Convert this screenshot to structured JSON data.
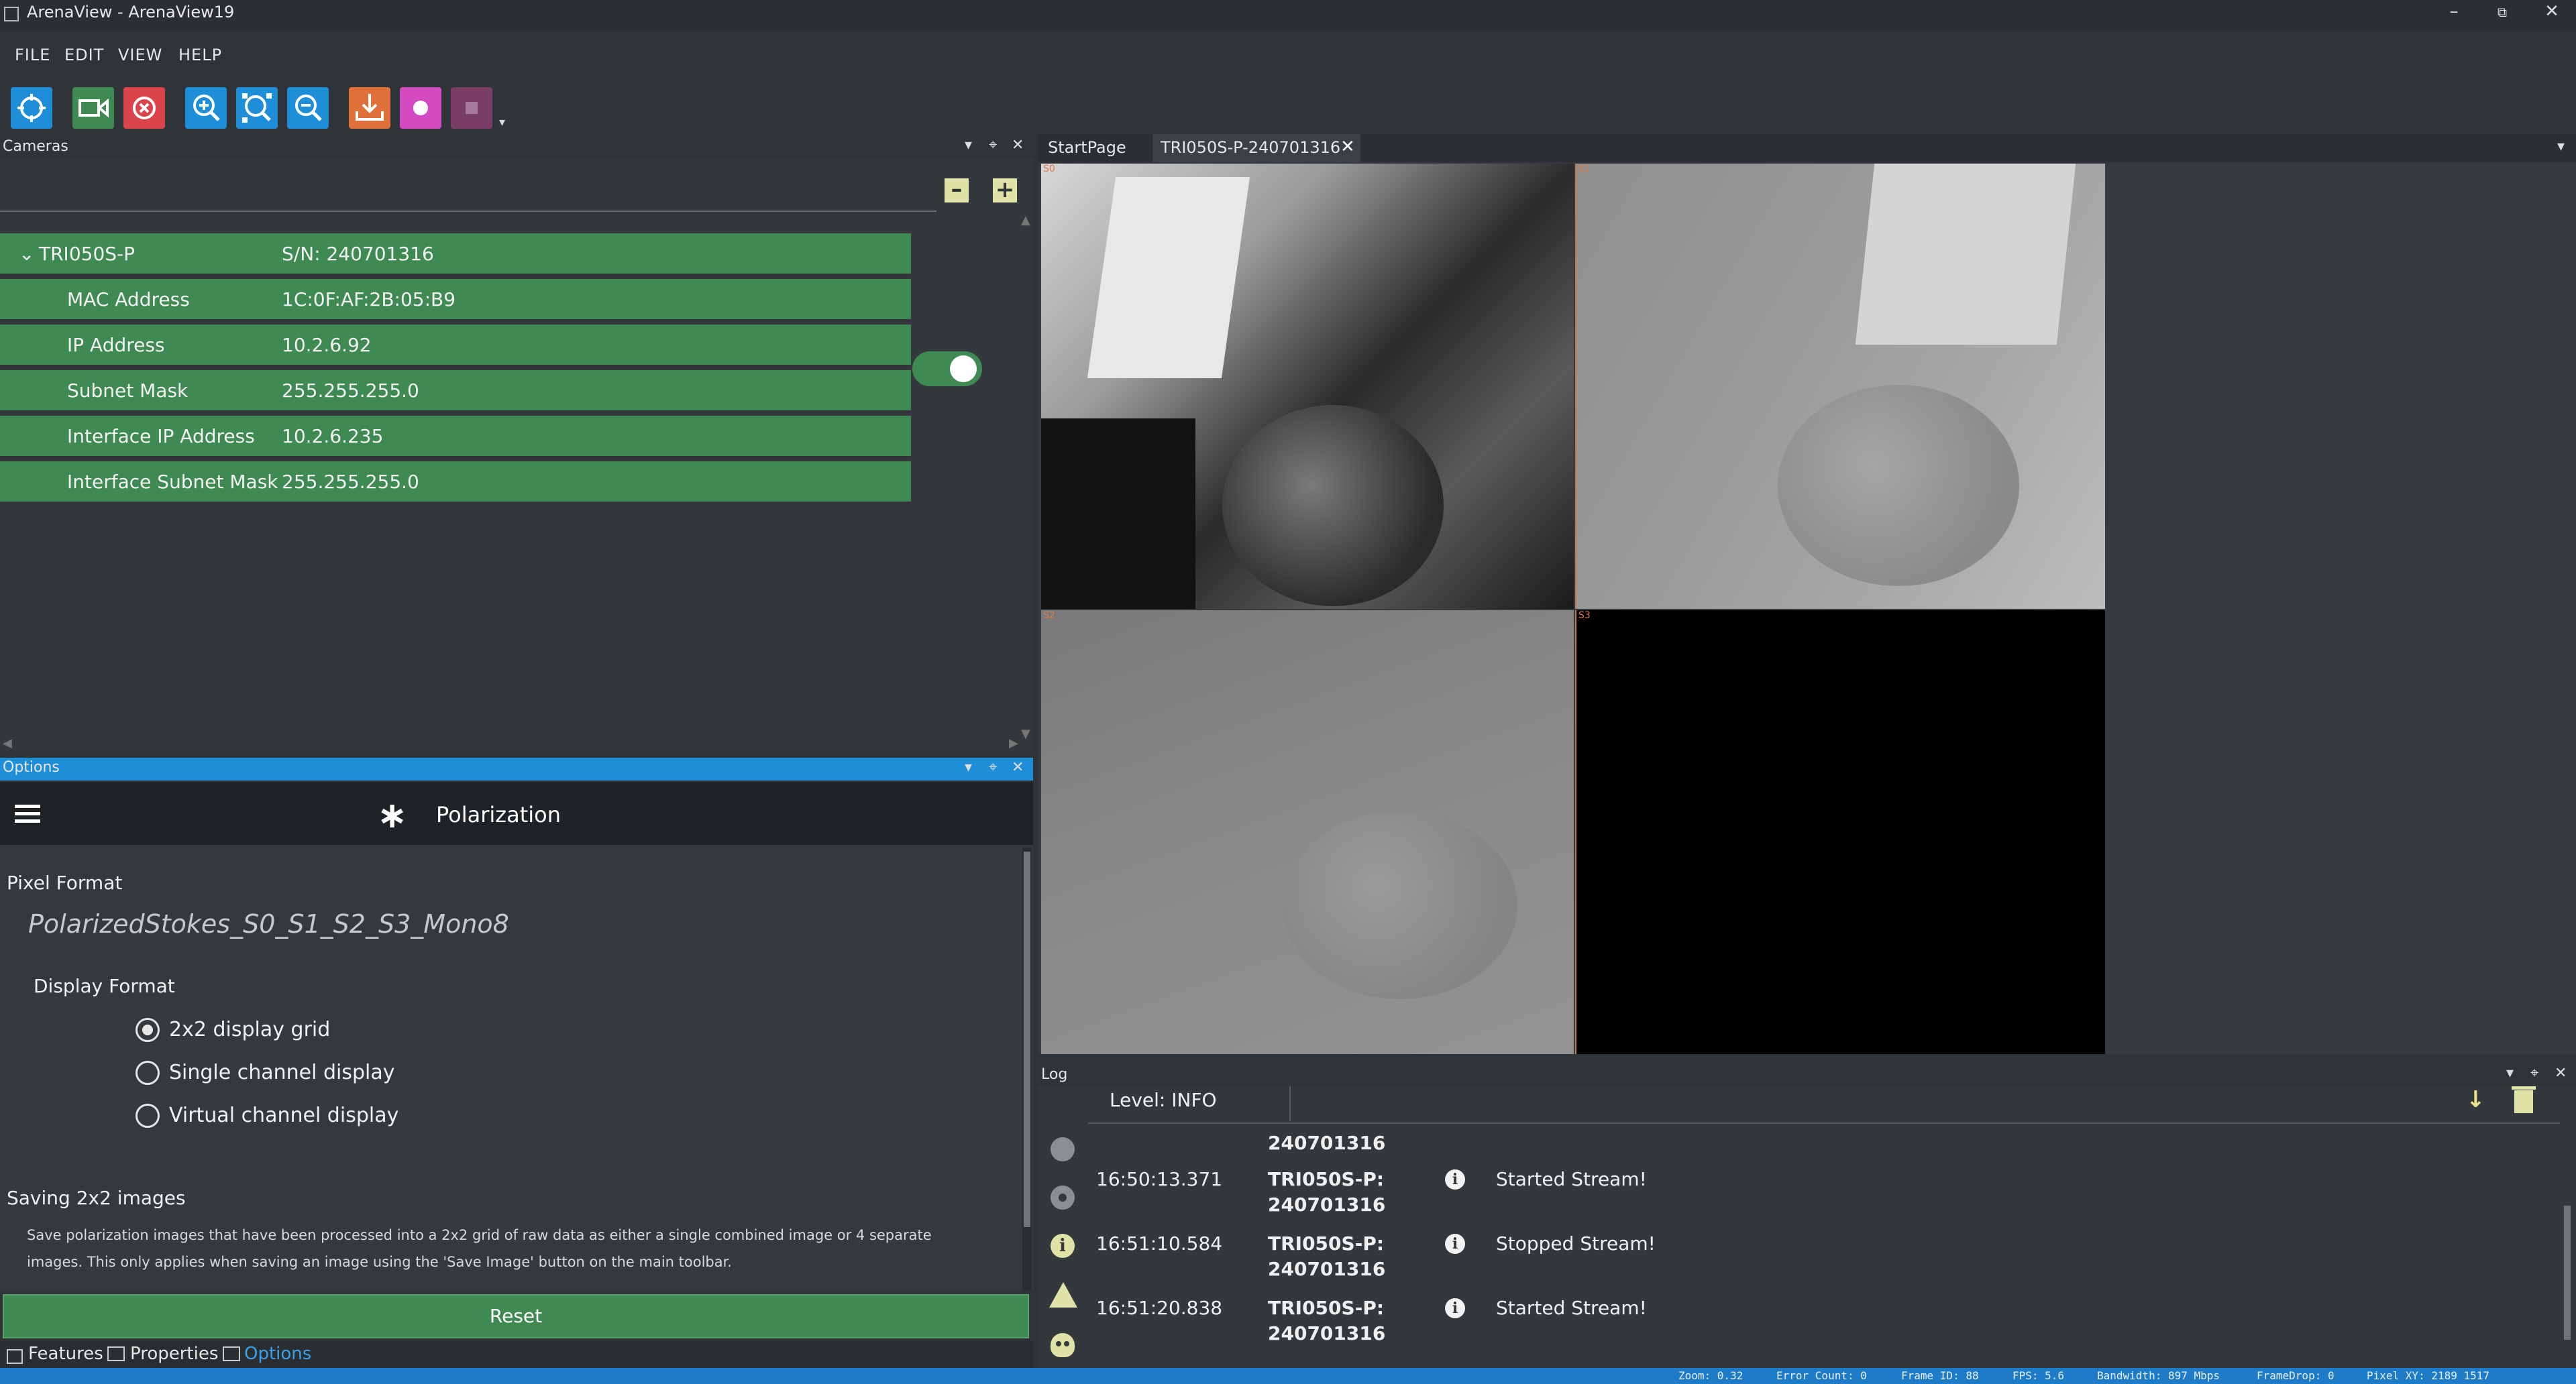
{
  "window": {
    "title": "ArenaView - ArenaView19"
  },
  "menu": [
    "FILE",
    "EDIT",
    "VIEW",
    "HELP"
  ],
  "toolbar": {
    "buttons": [
      {
        "name": "select-camera",
        "color": "#1e8ed8"
      },
      {
        "name": "start-stream",
        "color": "#3f8a52"
      },
      {
        "name": "stop-stream",
        "color": "#d9454b"
      },
      {
        "name": "zoom-in",
        "color": "#1e8ed8"
      },
      {
        "name": "zoom-fit",
        "color": "#1e8ed8"
      },
      {
        "name": "zoom-out",
        "color": "#1e8ed8"
      },
      {
        "name": "save-image",
        "color": "#e0703a"
      },
      {
        "name": "record",
        "color": "#d44ac0"
      },
      {
        "name": "stop-record",
        "color": "#7a3d66"
      }
    ]
  },
  "cameras": {
    "title": "Cameras",
    "device": {
      "name": "TRI050S-P",
      "serial": "S/N: 240701316"
    },
    "rows": [
      {
        "key": "MAC Address",
        "value": "1C:0F:AF:2B:05:B9"
      },
      {
        "key": "IP Address",
        "value": "10.2.6.92"
      },
      {
        "key": "Subnet Mask",
        "value": "255.255.255.0"
      },
      {
        "key": "Interface IP Address",
        "value": "10.2.6.235"
      },
      {
        "key": "Interface Subnet Mask",
        "value": "255.255.255.0"
      }
    ],
    "toggle_on": true
  },
  "options": {
    "title": "Options",
    "header": "Polarization",
    "pixel_format_label": "Pixel Format",
    "pixel_format_value": "PolarizedStokes_S0_S1_S2_S3_Mono8",
    "display_format_label": "Display Format",
    "display_options": [
      {
        "label": "2x2 display grid",
        "selected": true
      },
      {
        "label": "Single channel display",
        "selected": false
      },
      {
        "label": "Virtual channel display",
        "selected": false
      }
    ],
    "saving_label": "Saving 2x2 images",
    "saving_desc_1": "Save polarization images that have been processed into a 2x2 grid of raw data as either a single combined image or 4 separate",
    "saving_desc_2": "images. This only applies when saving an image using the 'Save Image' button on the main toolbar.",
    "reset_label": "Reset"
  },
  "bottom_tabs": [
    "Features",
    "Properties",
    "Options"
  ],
  "view": {
    "tabs": [
      {
        "label": "StartPage",
        "active": false
      },
      {
        "label": "TRI050S-P-240701316",
        "active": true
      }
    ],
    "channels": [
      "S0",
      "S1",
      "S2",
      "S3"
    ]
  },
  "log": {
    "title": "Log",
    "level_label": "Level: INFO",
    "entries": [
      {
        "time": "",
        "source_1": "",
        "source_2": "240701316",
        "message": ""
      },
      {
        "time": "16:50:13.371",
        "source_1": "TRI050S-P:",
        "source_2": "240701316",
        "message": "Started Stream!"
      },
      {
        "time": "16:51:10.584",
        "source_1": "TRI050S-P:",
        "source_2": "240701316",
        "message": "Stopped Stream!"
      },
      {
        "time": "16:51:20.838",
        "source_1": "TRI050S-P:",
        "source_2": "240701316",
        "message": "Started Stream!"
      }
    ]
  },
  "status": {
    "zoom": "Zoom: 0.32",
    "error_count": "Error Count: 0",
    "frame_id": "Frame ID: 88",
    "fps": "FPS: 5.6",
    "bandwidth": "Bandwidth: 897 Mbps",
    "frame_drop": "FrameDrop: 0",
    "pixel_xy": "Pixel XY: 2189 1517"
  },
  "colors": {
    "accent_blue": "#1e8ed8",
    "row_green": "#3f8a52",
    "background": "#2f3438"
  }
}
